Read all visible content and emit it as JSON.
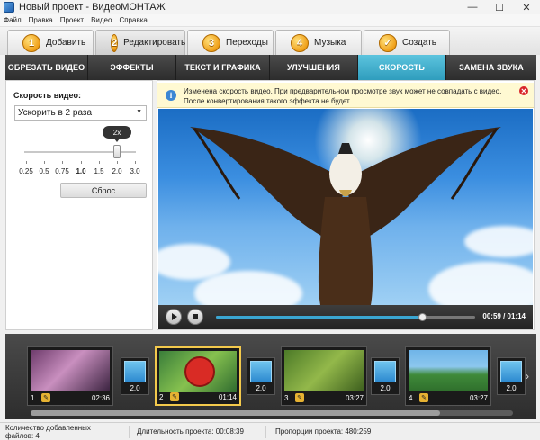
{
  "window": {
    "title": "Новый проект - ВидеоМОНТАЖ",
    "minimize": "—",
    "maximize": "☐",
    "close": "✕"
  },
  "menu": [
    "Файл",
    "Правка",
    "Проект",
    "Видео",
    "Справка"
  ],
  "steps": [
    {
      "num": "1",
      "label": "Добавить"
    },
    {
      "num": "2",
      "label": "Редактировать"
    },
    {
      "num": "3",
      "label": "Переходы"
    },
    {
      "num": "4",
      "label": "Музыка"
    },
    {
      "num": "✓",
      "label": "Создать"
    }
  ],
  "tabs": [
    "ОБРЕЗАТЬ ВИДЕО",
    "ЭФФЕКТЫ",
    "ТЕКСТ И ГРАФИКА",
    "УЛУЧШЕНИЯ",
    "СКОРОСТЬ",
    "ЗАМЕНА ЗВУКА"
  ],
  "active_tab": "СКОРОСТЬ",
  "speed": {
    "label": "Скорость видео:",
    "selected": "Ускорить в 2 раза",
    "tooltip": "2x",
    "ticks": [
      "0.25",
      "0.5",
      "0.75",
      "1.0",
      "1.5",
      "2.0",
      "3.0"
    ],
    "value": "2.0",
    "reset": "Сброс"
  },
  "notice": {
    "text": "Изменена скорость видео. При предварительном просмотре звук может не совпадать с видео. После конвертирования такого эффекта не будет."
  },
  "player": {
    "time": "00:59 / 01:14",
    "progress": 0.8
  },
  "timeline": {
    "clips": [
      {
        "num": "1",
        "duration": "02:36"
      },
      {
        "num": "2",
        "duration": "01:14"
      },
      {
        "num": "3",
        "duration": "03:27"
      },
      {
        "num": "4",
        "duration": "03:27"
      }
    ],
    "transitions": [
      "2.0",
      "2.0",
      "2.0",
      "2.0"
    ],
    "selected_clip": "2"
  },
  "status": {
    "files": "Количество добавленных файлов: 4",
    "duration": "Длительность проекта: 00:08:39",
    "ratio": "Пропорции проекта: 480:259"
  }
}
